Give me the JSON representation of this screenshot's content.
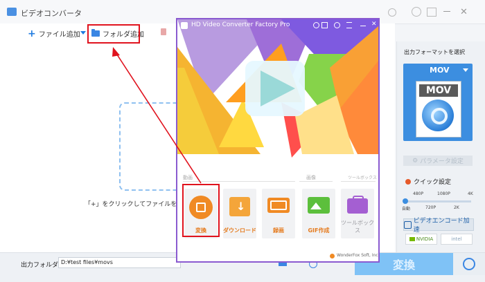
{
  "app": {
    "title": "ビデオコンバータ",
    "toolbar": {
      "add_file": "ファイル追加",
      "add_folder": "フォルダ追加"
    },
    "drop_hint": "「+」をクリックしてファイルを追加"
  },
  "right_panel": {
    "output_format_title": "出力フォーマットを選択",
    "format_selected": "MOV",
    "format_tile_text": "MOV",
    "param_button": "パラメータ設定",
    "quick_settings_title": "クイック設定",
    "quality_top_labels": [
      "480P",
      "1080P",
      "4K"
    ],
    "quality_bottom_labels": [
      "自動",
      "720P",
      "2K"
    ],
    "hw_accel_button": "ビデオエンコード加速",
    "gpu_badges": [
      "NVIDIA",
      "intel"
    ]
  },
  "bottom": {
    "output_folder_label": "出力フォルダ：",
    "output_folder_value": "D:¥test files¥movs",
    "convert_button": "変換"
  },
  "launcher": {
    "title": "HD Video Converter Factory Pro",
    "sections": {
      "video": "動画",
      "image": "画像",
      "toolbox": "ツールボックス"
    },
    "tiles": [
      {
        "label": "変換"
      },
      {
        "label": "ダウンロード"
      },
      {
        "label": "録画"
      },
      {
        "label": "GIF作成"
      },
      {
        "label": "ツールボックス"
      }
    ],
    "footer": "WonderFox Soft, Inc"
  },
  "colors": {
    "accent_blue": "#3c8ee0",
    "highlight_red": "#e0121d",
    "launcher_border": "#8a5ad0",
    "tile_orange": "#f08a24"
  }
}
